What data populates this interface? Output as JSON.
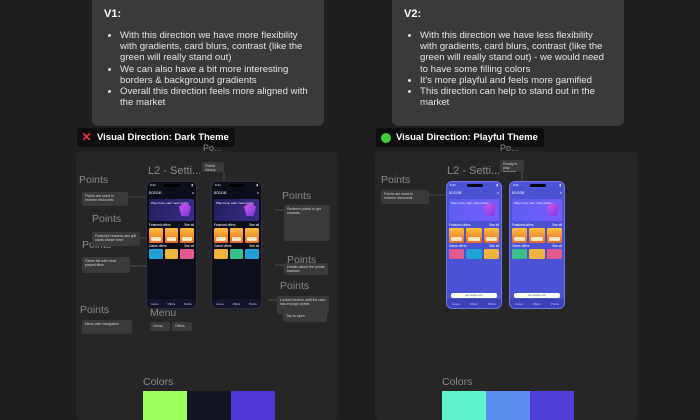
{
  "notes": {
    "v1": {
      "title": "V1:",
      "bullets": [
        "With this direction we have more flexibility with gradients, card blurs, contrast (like the green will really stand out)",
        "We can also have a bit more interesting borders & background gradients",
        "Overall this direction feels more aligned with the market"
      ]
    },
    "v2": {
      "title": "V2:",
      "bullets": [
        "With this direction we have less flexibility with gradients, card blurs, contrast (like the green will really stand out) - we would need to have some filling colors",
        "It's more playful and feels more gamified",
        "This direction can help to stand out in the market"
      ]
    }
  },
  "directions": {
    "dark": {
      "label": "Visual Direction: Dark Theme",
      "status_icon": "x-icon",
      "status_color": "#e8333c"
    },
    "playful": {
      "label": "Visual Direction: Playful Theme",
      "status_icon": "green-dot-icon",
      "status_color": "#3ecf3e"
    }
  },
  "dark_frame": {
    "po_label": "Po...",
    "settings_label": "L2 - Setti...",
    "points_labels": [
      "Points",
      "Points",
      "Points",
      "Points",
      "Points",
      "Points",
      "Points"
    ],
    "menu_label": "Menu",
    "colors_label": "Colors",
    "notes": [
      "Points are used to redeem discounts",
      "Featured rewards and gift cards shown here",
      "Game list with most played titles",
      "Redeem points to get rewards",
      "Details about the points balance",
      "Points history",
      "Locked section until the user has enough points",
      "Menu with navigation",
      "Tap to open"
    ],
    "swatches": [
      "#9cff5c",
      "#141624",
      "#4f36d6"
    ]
  },
  "play_frame": {
    "po_label": "Po...",
    "settings_label": "L2 - Setti...",
    "points_label": "Points",
    "colors_label": "Colors",
    "notes": [
      "Points are used to redeem discounts",
      "Ready to play rewards and more games"
    ],
    "swatches": [
      "#5ff2c9",
      "#5a8cf0",
      "#4f3fd8"
    ]
  },
  "phone": {
    "time": "9:41",
    "brand": "BOOGIE",
    "hero_text": "Play more, earn more points",
    "featured": "Featured offers",
    "games": "Game offers",
    "see_all": "See all",
    "tabs": [
      "Home",
      "Offers",
      "Points",
      "Profile"
    ],
    "url": "app.boogie.com"
  }
}
